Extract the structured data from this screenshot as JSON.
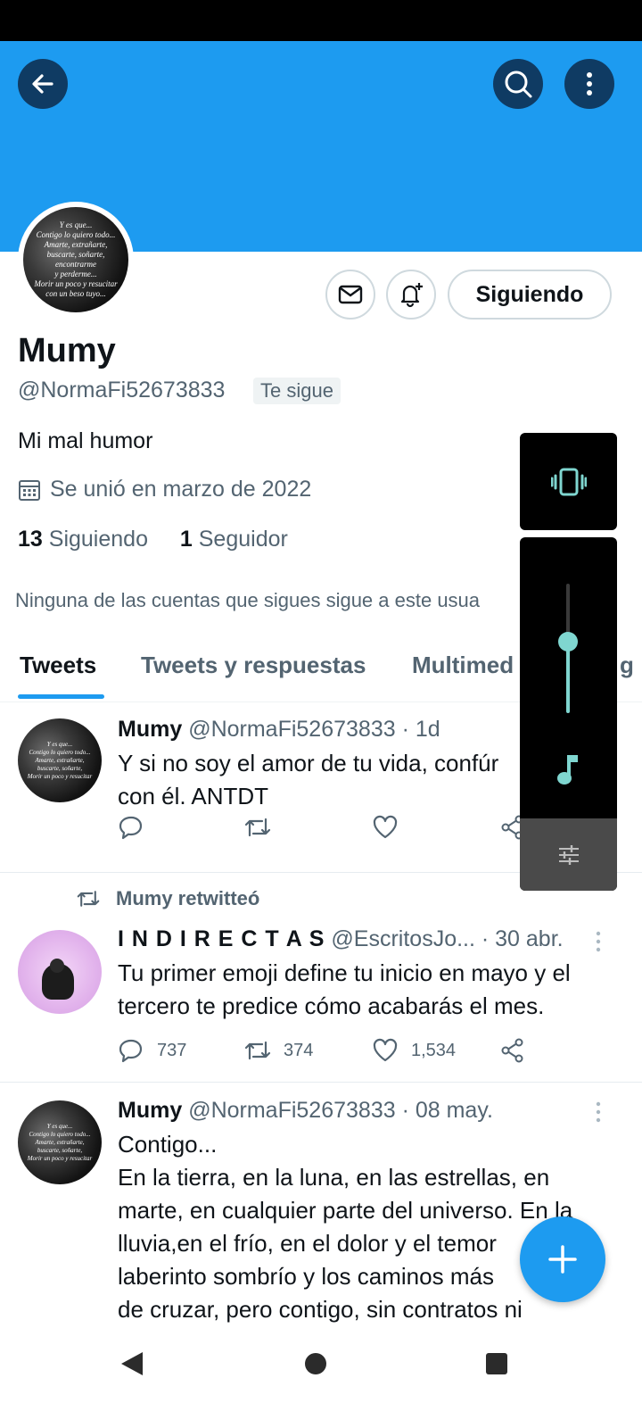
{
  "header": {
    "back_icon": "arrow-left-icon",
    "search_icon": "search-icon",
    "more_icon": "more-vertical-icon",
    "banner_color": "#1d9bf0"
  },
  "profile": {
    "avatar_text": [
      "Y es que...",
      "Contigo lo quiero todo...",
      "Amarte, extrañarte,",
      "buscarte, soñarte,",
      "encontrarme",
      "y perderme...",
      "Morir un poco y resucitar",
      "con un beso tuyo..."
    ],
    "name": "Mumy",
    "handle": "@NormaFi52673833",
    "follows_you": "Te sigue",
    "bio": "Mi mal humor",
    "joined": "Se unió en marzo de 2022",
    "following_count": "13",
    "following_label": "Siguiendo",
    "followers_count": "1",
    "followers_label": "Seguidor",
    "followed_by_note": "Ninguna de las cuentas que sigues sigue a este usua",
    "following_button": "Siguiendo"
  },
  "tabs": [
    {
      "label": "Tweets",
      "active": true
    },
    {
      "label": "Tweets y respuestas",
      "active": false
    },
    {
      "label": "Multimed",
      "active": false
    },
    {
      "label": "g",
      "active": false
    }
  ],
  "tweets": [
    {
      "name": "Mumy",
      "meta": "@NormaFi52673833 · 1d",
      "lines": [
        "Y si no soy el amor de tu vida, confúr",
        "con él.  ANTDT"
      ]
    },
    {
      "retweet_note": "Mumy retwitteó",
      "name": "I N D I R E C T A S",
      "meta": "@EscritosJo... · 30 abr.",
      "lines": [
        "Tu primer emoji define tu inicio en mayo y el",
        "tercero te predice cómo acabarás el mes."
      ],
      "replies": "737",
      "retweets": "374",
      "likes": "1,534"
    },
    {
      "name": "Mumy",
      "meta": "@NormaFi52673833 · 08 may.",
      "lines": [
        "Contigo...",
        "En la tierra, en la luna, en las estrellas, en",
        "marte, en cualquier parte del universo.  En la",
        "lluvia,en el frío, en el dolor y  el temor",
        "laberinto sombrío y los caminos más",
        "de cruzar, pero contigo, sin contratos ni"
      ]
    }
  ],
  "volume_panel": {
    "vibrate_icon": "vibrate-icon",
    "music_icon": "music-note-icon",
    "settings_icon": "equalizer-icon",
    "level": 0.55,
    "accent": "#7fd6d0"
  },
  "fab": {
    "icon": "plus-icon",
    "color": "#1d9bf0"
  },
  "navbar": {
    "back": "nav-back-icon",
    "home": "nav-home-icon",
    "recents": "nav-recents-icon"
  }
}
